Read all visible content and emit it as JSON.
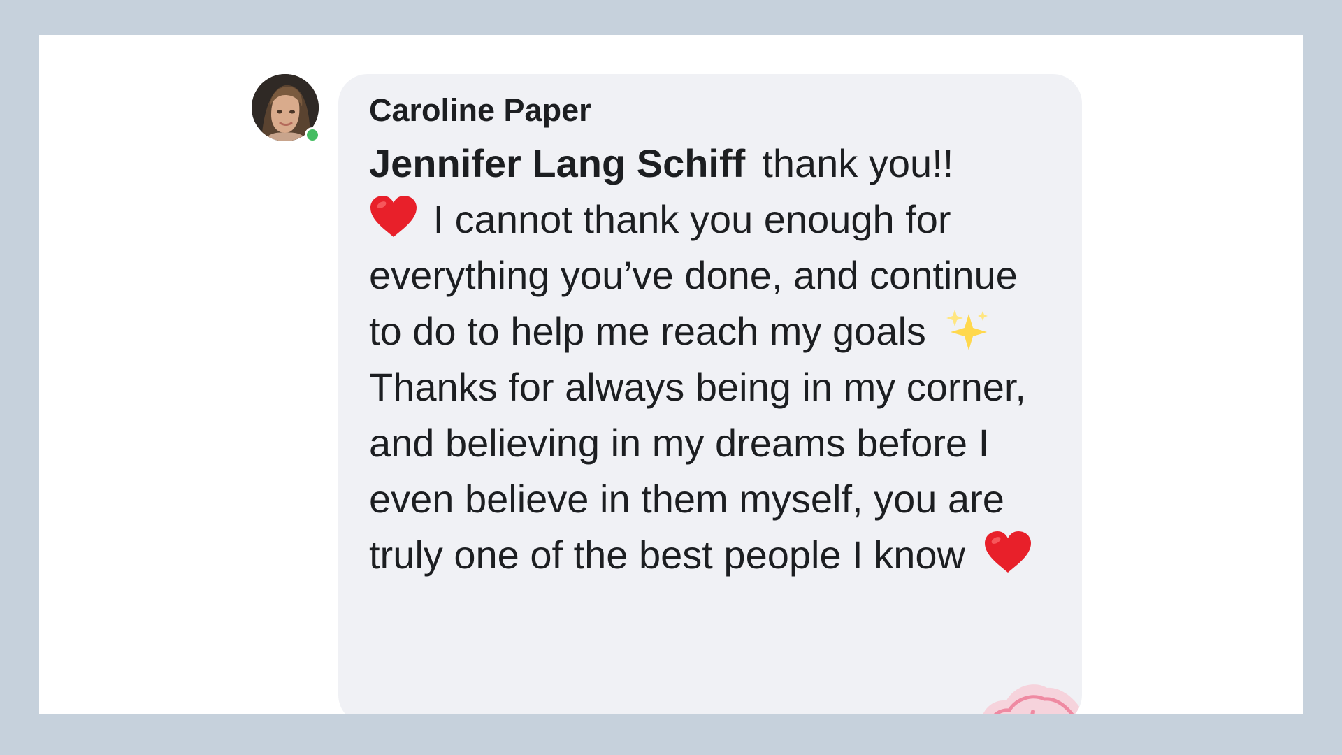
{
  "comment": {
    "author": "Caroline Paper",
    "mention": "Jennifer Lang Schiff",
    "text_1": "thank you!!",
    "text_2": "I cannot thank you enough for everything you’ve done, and continue to do to help me reach my goals",
    "text_3": "Thanks for always being in my corner, and believing in my dreams before I even believe in them myself, you are truly one of the best people I know",
    "avatar_icon": "profile-photo",
    "online_status_color": "#45bd62",
    "reaction_emojis": [
      "red-heart-icon",
      "sparkles-icon",
      "red-heart-icon"
    ]
  },
  "colors": {
    "page_background": "#c6d1dc",
    "card_background": "#ffffff",
    "bubble_background": "#f0f1f5",
    "text": "#1c1e21",
    "heart": "#e8202a"
  }
}
